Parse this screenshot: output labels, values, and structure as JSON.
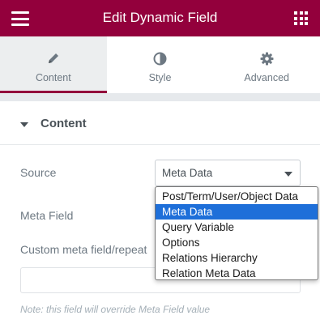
{
  "header": {
    "title": "Edit Dynamic Field",
    "menu_icon": "hamburger-icon",
    "apps_icon": "grid-icon",
    "background": "#93003c"
  },
  "tabs": [
    {
      "label": "Content",
      "icon": "pencil-icon",
      "active": true
    },
    {
      "label": "Style",
      "icon": "half-circle-icon",
      "active": false
    },
    {
      "label": "Advanced",
      "icon": "gear-icon",
      "active": false
    }
  ],
  "section": {
    "title": "Content",
    "expanded": true
  },
  "form": {
    "source_label": "Source",
    "source_value": "Meta Data",
    "meta_field_label": "Meta Field",
    "custom_meta_label": "Custom meta field/repeat",
    "custom_meta_value": "",
    "note": "Note: this field will override Meta Field value"
  },
  "dropdown": {
    "options": [
      "Post/Term/User/Object Data",
      "Meta Data",
      "Query Variable",
      "Options",
      "Relations Hierarchy",
      "Relation Meta Data"
    ],
    "selected_index": 1
  },
  "colors": {
    "accent": "#93003c",
    "selection": "#1e6fd9"
  }
}
